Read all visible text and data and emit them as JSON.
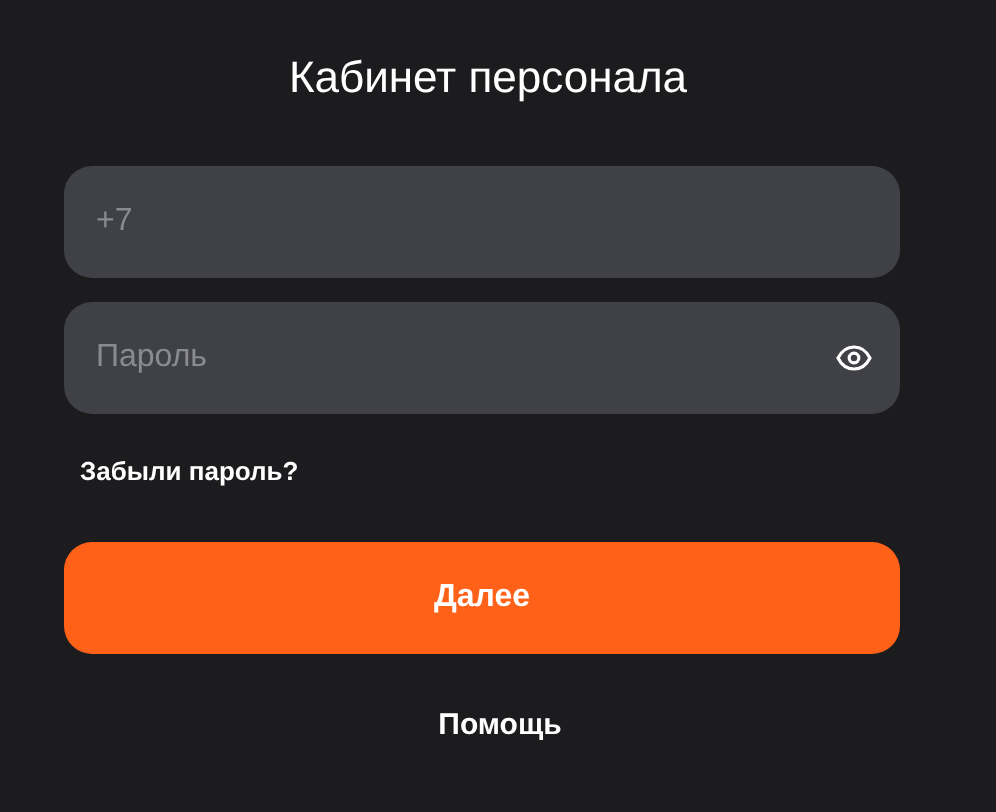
{
  "title": "Кабинет персонала",
  "phone_field": {
    "placeholder": "+7"
  },
  "password_field": {
    "placeholder": "Пароль"
  },
  "forgot_link": "Забыли пароль?",
  "submit_button": "Далее",
  "help_link": "Помощь"
}
